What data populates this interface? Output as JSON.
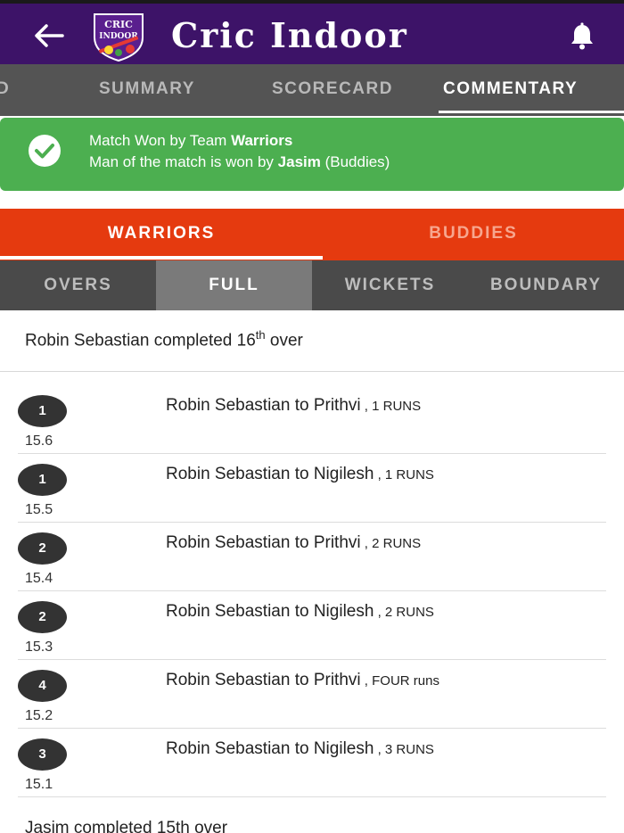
{
  "header": {
    "app_title": "Cric Indoor",
    "logo_text_line1": "CRIC",
    "logo_text_line2": "INDOOR"
  },
  "tabs": [
    {
      "label": "SUMMARY",
      "active": false
    },
    {
      "label": "SCORECARD",
      "active": false
    },
    {
      "label": "COMMENTARY",
      "active": true
    }
  ],
  "result": {
    "line1_prefix": "Match Won by Team ",
    "winner": "Warriors",
    "line2_prefix": "Man of the match is won by ",
    "mom_name": "Jasim",
    "mom_team": " (Buddies)"
  },
  "teams": [
    {
      "label": "WARRIORS",
      "active": true
    },
    {
      "label": "BUDDIES",
      "active": false
    }
  ],
  "filters": [
    {
      "label": "OVERS",
      "active": false
    },
    {
      "label": "FULL",
      "active": true
    },
    {
      "label": "WICKETS",
      "active": false
    },
    {
      "label": "BOUNDARY",
      "active": false
    }
  ],
  "over_summary": {
    "prefix": "Robin Sebastian completed 16",
    "suffix": "th",
    "end": " over"
  },
  "balls": [
    {
      "runs": "1",
      "over": "15.6",
      "text": "Robin Sebastian to Prithvi",
      "result": " , 1 RUNS"
    },
    {
      "runs": "1",
      "over": "15.5",
      "text": "Robin Sebastian to Nigilesh",
      "result": " , 1 RUNS"
    },
    {
      "runs": "2",
      "over": "15.4",
      "text": "Robin Sebastian to Prithvi",
      "result": " , 2 RUNS"
    },
    {
      "runs": "2",
      "over": "15.3",
      "text": "Robin Sebastian to Nigilesh",
      "result": " , 2 RUNS"
    },
    {
      "runs": "4",
      "over": "15.2",
      "text": "Robin Sebastian to Prithvi",
      "result": " , FOUR runs"
    },
    {
      "runs": "3",
      "over": "15.1",
      "text": "Robin Sebastian to Nigilesh",
      "result": " , 3 RUNS"
    }
  ],
  "next_summary_partial": "Jasim completed 15th over",
  "colors": {
    "header_bg": "#3d1368",
    "tabbar_bg": "#545454",
    "result_bg": "#4caf50",
    "team_bar_bg": "#e53a0f",
    "filter_bg": "#4a4a4a",
    "filter_active_bg": "#7a7a7a",
    "ball_badge": "#333333"
  },
  "icons": {
    "back": "arrow-left-icon",
    "notifications": "bell-icon",
    "result": "check-circle-icon"
  }
}
